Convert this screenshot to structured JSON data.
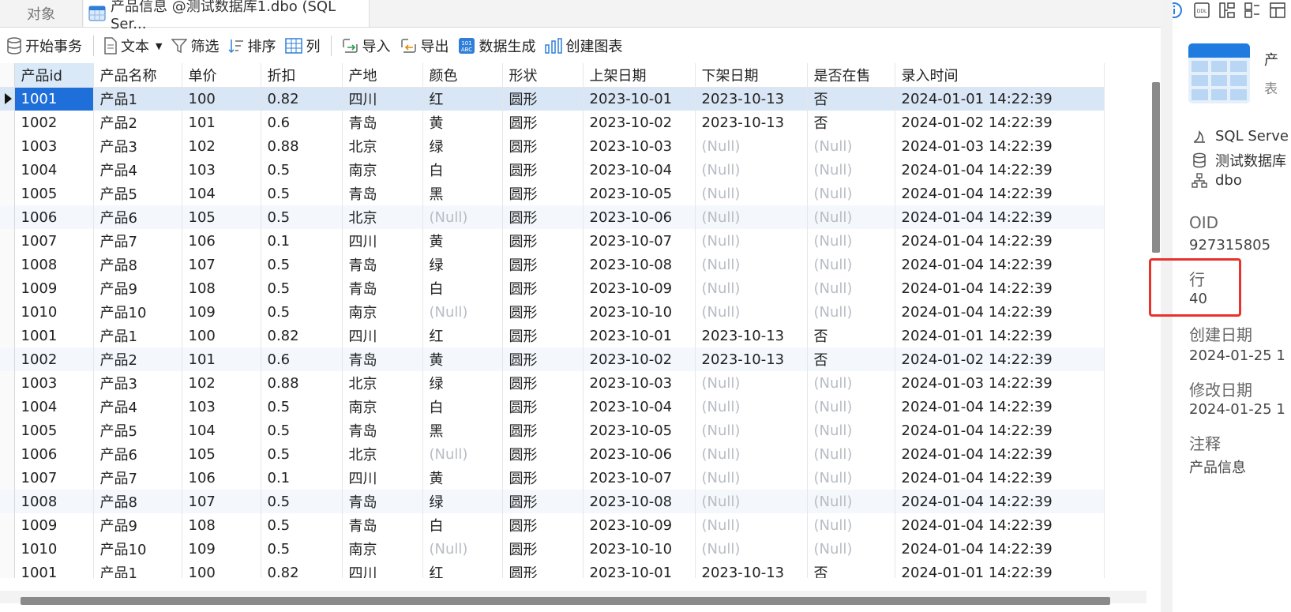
{
  "tabs": {
    "objects": "对象",
    "active": "产品信息 @测试数据库1.dbo (SQL Ser..."
  },
  "toolbar": {
    "begin_tx": "开始事务",
    "text": "文本",
    "filter": "筛选",
    "sort": "排序",
    "columns": "列",
    "import": "导入",
    "export": "导出",
    "datagen": "数据生成",
    "chart": "创建图表"
  },
  "grid": {
    "columns": [
      "产品id",
      "产品名称",
      "单价",
      "折扣",
      "产地",
      "颜色",
      "形状",
      "上架日期",
      "下架日期",
      "是否在售",
      "录入时间"
    ],
    "rows": [
      [
        "1001",
        "产品1",
        "100",
        "0.82",
        "四川",
        "红",
        "圆形",
        "2023-10-01",
        "2023-10-13",
        "否",
        "2024-01-01 14:22:39"
      ],
      [
        "1002",
        "产品2",
        "101",
        "0.6",
        "青岛",
        "黄",
        "圆形",
        "2023-10-02",
        "2023-10-13",
        "否",
        "2024-01-02 14:22:39"
      ],
      [
        "1003",
        "产品3",
        "102",
        "0.88",
        "北京",
        "绿",
        "圆形",
        "2023-10-03",
        "(Null)",
        "(Null)",
        "2024-01-03 14:22:39"
      ],
      [
        "1004",
        "产品4",
        "103",
        "0.5",
        "南京",
        "白",
        "圆形",
        "2023-10-04",
        "(Null)",
        "(Null)",
        "2024-01-04 14:22:39"
      ],
      [
        "1005",
        "产品5",
        "104",
        "0.5",
        "青岛",
        "黑",
        "圆形",
        "2023-10-05",
        "(Null)",
        "(Null)",
        "2024-01-04 14:22:39"
      ],
      [
        "1006",
        "产品6",
        "105",
        "0.5",
        "北京",
        "(Null)",
        "圆形",
        "2023-10-06",
        "(Null)",
        "(Null)",
        "2024-01-04 14:22:39"
      ],
      [
        "1007",
        "产品7",
        "106",
        "0.1",
        "四川",
        "黄",
        "圆形",
        "2023-10-07",
        "(Null)",
        "(Null)",
        "2024-01-04 14:22:39"
      ],
      [
        "1008",
        "产品8",
        "107",
        "0.5",
        "青岛",
        "绿",
        "圆形",
        "2023-10-08",
        "(Null)",
        "(Null)",
        "2024-01-04 14:22:39"
      ],
      [
        "1009",
        "产品9",
        "108",
        "0.5",
        "青岛",
        "白",
        "圆形",
        "2023-10-09",
        "(Null)",
        "(Null)",
        "2024-01-04 14:22:39"
      ],
      [
        "1010",
        "产品10",
        "109",
        "0.5",
        "南京",
        "(Null)",
        "圆形",
        "2023-10-10",
        "(Null)",
        "(Null)",
        "2024-01-04 14:22:39"
      ],
      [
        "1001",
        "产品1",
        "100",
        "0.82",
        "四川",
        "红",
        "圆形",
        "2023-10-01",
        "2023-10-13",
        "否",
        "2024-01-01 14:22:39"
      ],
      [
        "1002",
        "产品2",
        "101",
        "0.6",
        "青岛",
        "黄",
        "圆形",
        "2023-10-02",
        "2023-10-13",
        "否",
        "2024-01-02 14:22:39"
      ],
      [
        "1003",
        "产品3",
        "102",
        "0.88",
        "北京",
        "绿",
        "圆形",
        "2023-10-03",
        "(Null)",
        "(Null)",
        "2024-01-03 14:22:39"
      ],
      [
        "1004",
        "产品4",
        "103",
        "0.5",
        "南京",
        "白",
        "圆形",
        "2023-10-04",
        "(Null)",
        "(Null)",
        "2024-01-04 14:22:39"
      ],
      [
        "1005",
        "产品5",
        "104",
        "0.5",
        "青岛",
        "黑",
        "圆形",
        "2023-10-05",
        "(Null)",
        "(Null)",
        "2024-01-04 14:22:39"
      ],
      [
        "1006",
        "产品6",
        "105",
        "0.5",
        "北京",
        "(Null)",
        "圆形",
        "2023-10-06",
        "(Null)",
        "(Null)",
        "2024-01-04 14:22:39"
      ],
      [
        "1007",
        "产品7",
        "106",
        "0.1",
        "四川",
        "黄",
        "圆形",
        "2023-10-07",
        "(Null)",
        "(Null)",
        "2024-01-04 14:22:39"
      ],
      [
        "1008",
        "产品8",
        "107",
        "0.5",
        "青岛",
        "绿",
        "圆形",
        "2023-10-08",
        "(Null)",
        "(Null)",
        "2024-01-04 14:22:39"
      ],
      [
        "1009",
        "产品9",
        "108",
        "0.5",
        "青岛",
        "白",
        "圆形",
        "2023-10-09",
        "(Null)",
        "(Null)",
        "2024-01-04 14:22:39"
      ],
      [
        "1010",
        "产品10",
        "109",
        "0.5",
        "南京",
        "(Null)",
        "圆形",
        "2023-10-10",
        "(Null)",
        "(Null)",
        "2024-01-04 14:22:39"
      ],
      [
        "1001",
        "产品1",
        "100",
        "0.82",
        "四川",
        "红",
        "圆形",
        "2023-10-01",
        "2023-10-13",
        "否",
        "2024-01-01 14:22:39"
      ]
    ]
  },
  "panel": {
    "title": "产",
    "subtitle": "表",
    "server": "SQL Serve",
    "database": "测试数据库",
    "schema": "dbo",
    "oid_label": "OID",
    "oid_value": "927315805",
    "rows_label": "行",
    "rows_value": "40",
    "created_label": "创建日期",
    "created_value": "2024-01-25 1",
    "modified_label": "修改日期",
    "modified_value": "2024-01-25 1",
    "comment_label": "注释",
    "comment_value": "产品信息"
  },
  "colors": {
    "selection": "#1e6fd9",
    "current_row": "#d8e6f5",
    "null_text": "#b8bcc4",
    "highlight_box": "#e8322b"
  }
}
